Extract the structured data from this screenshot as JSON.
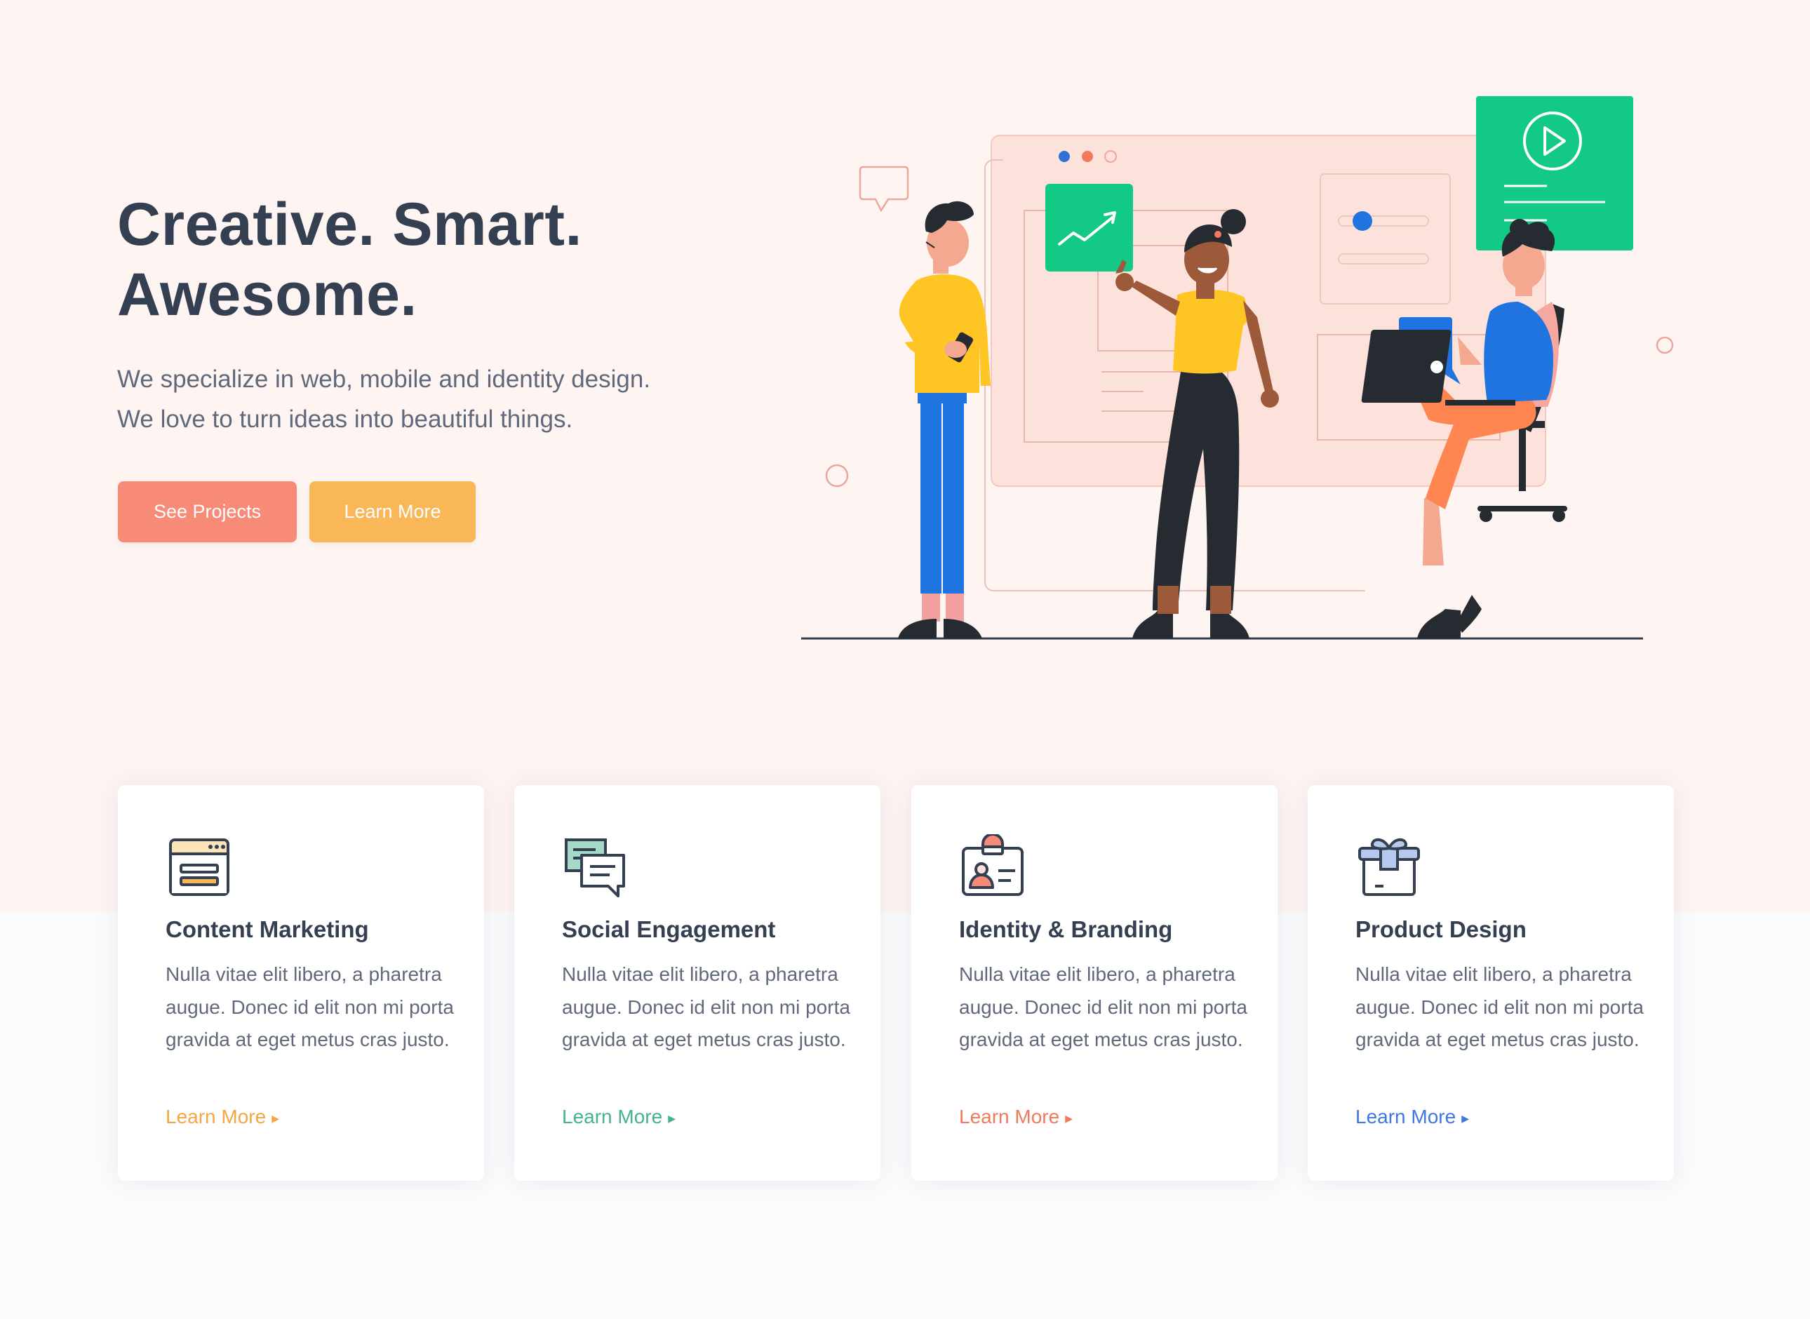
{
  "hero": {
    "title_line1": "Creative. Smart.",
    "title_line2": "Awesome.",
    "lead_line1": "We specialize in web, mobile and identity design.",
    "lead_line2": "We love to turn ideas into beautiful things.",
    "primary_button": "See Projects",
    "secondary_button": "Learn More"
  },
  "colors": {
    "hero_bg": "#fef4f2",
    "primary_button": "#f78b77",
    "secondary_button": "#fab758",
    "heading": "#343f52",
    "body_text": "#60697b"
  },
  "services": [
    {
      "icon": "browser-window-icon",
      "title": "Content Marketing",
      "text": "Nulla vitae elit libero, a pharetra augue. Donec id elit non mi porta gravida at eget metus cras justo.",
      "link": "Learn More",
      "link_color": "#f5a642"
    },
    {
      "icon": "chat-bubbles-icon",
      "title": "Social Engagement",
      "text": "Nulla vitae elit libero, a pharetra augue. Donec id elit non mi porta gravida at eget metus cras justo.",
      "link": "Learn More",
      "link_color": "#45b38b"
    },
    {
      "icon": "id-badge-icon",
      "title": "Identity & Branding",
      "text": "Nulla vitae elit libero, a pharetra augue. Donec id elit non mi porta gravida at eget metus cras justo.",
      "link": "Learn More",
      "link_color": "#f0795e"
    },
    {
      "icon": "gift-box-icon",
      "title": "Product Design",
      "text": "Nulla vitae elit libero, a pharetra augue. Donec id elit non mi porta gravida at eget metus cras justo.",
      "link": "Learn More",
      "link_color": "#3f78e0"
    }
  ]
}
